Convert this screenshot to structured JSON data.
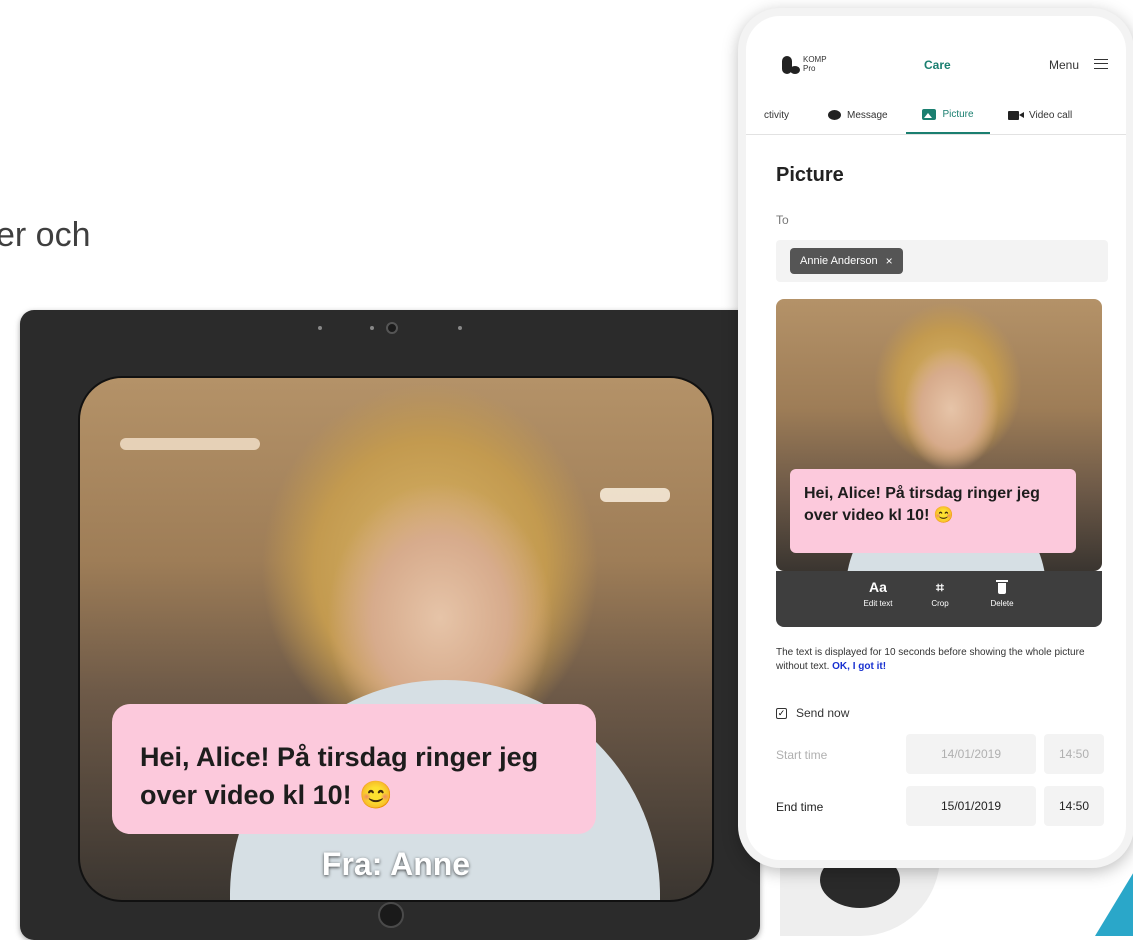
{
  "background": {
    "partial_text": "er och"
  },
  "tablet": {
    "message": "Hei, Alice! På tirsdag ringer jeg over video kl 10! 😊",
    "sender": "Fra: Anne"
  },
  "phone": {
    "header": {
      "logo_line1": "KOMP",
      "logo_line2": "Pro",
      "title": "Care",
      "menu_label": "Menu"
    },
    "tabs": [
      {
        "label": "ctivity"
      },
      {
        "label": "Message"
      },
      {
        "label": "Picture"
      },
      {
        "label": "Video call"
      }
    ],
    "page_title": "Picture",
    "to_label": "To",
    "recipient": "Annie Anderson",
    "remove_symbol": "×",
    "picture_message": "Hei, Alice! På tirsdag ringer jeg over video kl 10! 😊",
    "edit_actions": [
      {
        "glyph": "Aa",
        "label": "Edit text"
      },
      {
        "glyph": "⌗",
        "label": "Crop"
      },
      {
        "glyph": "",
        "label": "Delete"
      }
    ],
    "hint_text": "The text is displayed for 10 seconds before showing the whole picture without text.",
    "hint_link": "OK, I got it!",
    "send_now": {
      "label": "Send now",
      "checked": true
    },
    "start": {
      "label": "Start time",
      "date": "14/01/2019",
      "time": "14:50"
    },
    "end": {
      "label": "End time",
      "date": "15/01/2019",
      "time": "14:50"
    }
  },
  "colors": {
    "accent": "#1a7f70",
    "message_bubble": "#fcc9dc",
    "link": "#1730d0"
  }
}
